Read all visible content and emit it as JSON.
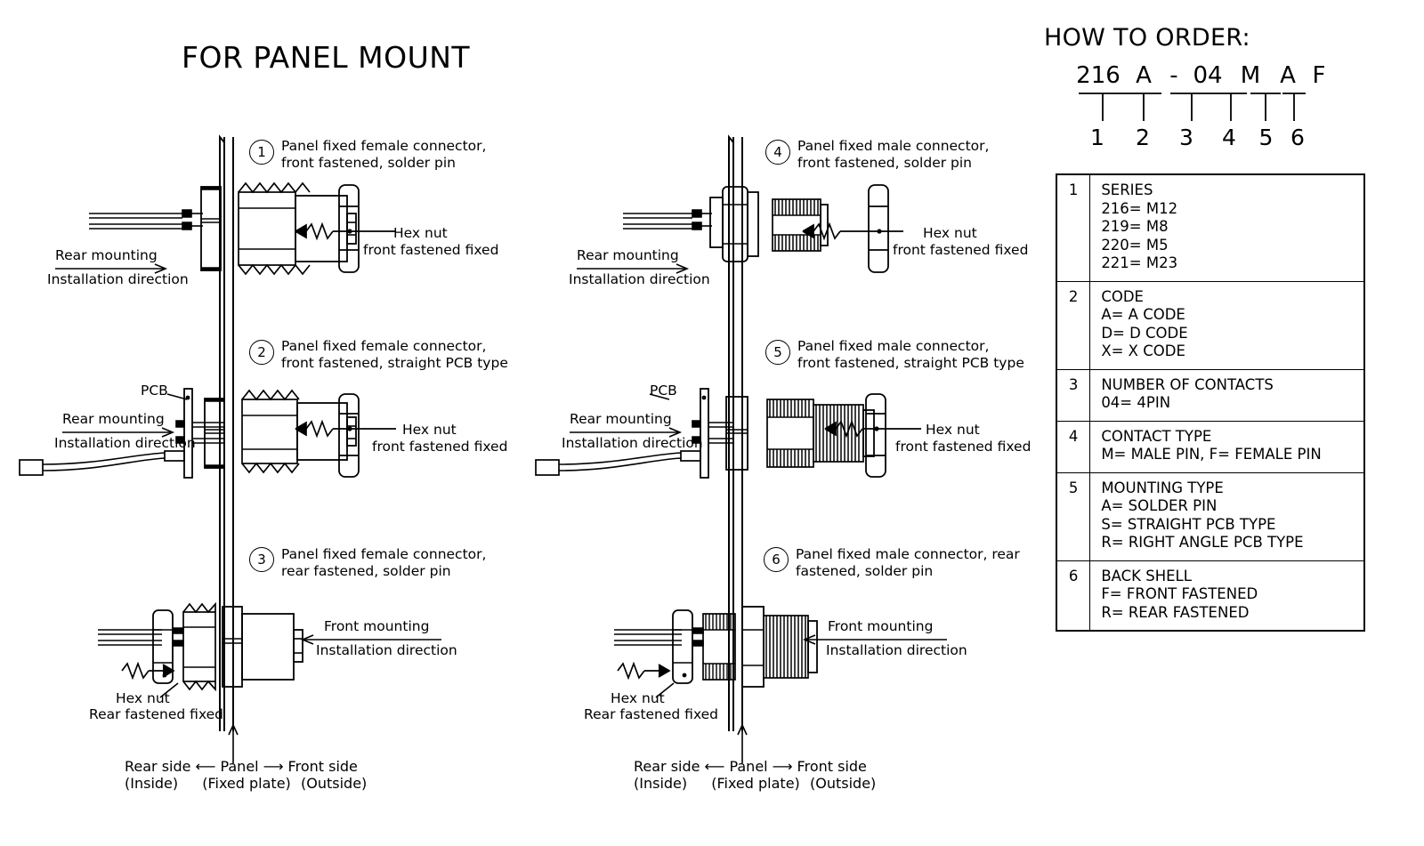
{
  "title": "FOR PANEL MOUNT",
  "order": {
    "heading": "HOW TO ORDER:",
    "code_parts": [
      "216",
      "A",
      "-",
      "04",
      "M",
      "A",
      "F"
    ],
    "code_display": "216 A - 04  M  A  F",
    "index_numbers": [
      "1",
      "2",
      "3",
      "4",
      "5",
      "6"
    ]
  },
  "spec_rows": [
    {
      "index": "1",
      "heading": "SERIES",
      "lines": [
        "216= M12",
        "219= M8",
        "220= M5",
        "221= M23"
      ]
    },
    {
      "index": "2",
      "heading": "CODE",
      "lines": [
        "A= A CODE",
        "D= D CODE",
        "X= X CODE"
      ]
    },
    {
      "index": "3",
      "heading": "NUMBER OF CONTACTS",
      "lines": [
        "04= 4PIN"
      ]
    },
    {
      "index": "4",
      "heading": "CONTACT TYPE",
      "lines": [
        "M= MALE PIN, F= FEMALE PIN"
      ]
    },
    {
      "index": "5",
      "heading": "MOUNTING TYPE",
      "lines": [
        "A= SOLDER PIN",
        "S= STRAIGHT PCB TYPE",
        "R= RIGHT ANGLE PCB TYPE"
      ]
    },
    {
      "index": "6",
      "heading": "BACK SHELL",
      "lines": [
        "F= FRONT FASTENED",
        "R= REAR FASTENED"
      ]
    }
  ],
  "callouts": [
    {
      "number": "1",
      "line1": "Panel fixed female connector,",
      "line2": "front fastened, solder pin"
    },
    {
      "number": "2",
      "line1": "Panel fixed female connector,",
      "line2": "front fastened, straight PCB type"
    },
    {
      "number": "3",
      "line1": "Panel fixed female connector,",
      "line2": "rear fastened, solder pin"
    },
    {
      "number": "4",
      "line1": "Panel fixed male connector,",
      "line2": "front fastened, solder pin"
    },
    {
      "number": "5",
      "line1": "Panel fixed male connector,",
      "line2": "front fastened, straight PCB type"
    },
    {
      "number": "6",
      "line1": "Panel fixed male connector, rear",
      "line2": "fastened, solder pin"
    }
  ],
  "annotations": {
    "rear_mounting": "Rear mounting",
    "front_mounting": "Front mounting",
    "installation_direction": "Installation direction",
    "hex_nut": "Hex nut",
    "hex_nut_front": "front fastened fixed",
    "hex_nut_rear_l1": "Hex nut",
    "hex_nut_rear_l2": "Rear fastened fixed",
    "pcb": "PCB"
  },
  "panel_legend": {
    "rear_side": "Rear side",
    "rear_side_sub": "(Inside)",
    "panel": "Panel",
    "panel_sub": "(Fixed plate)",
    "front_side": "Front side",
    "front_side_sub": "(Outside)",
    "left_arrow": "⟵",
    "right_arrow": "⟶"
  },
  "colors": {
    "line": "#000000",
    "background": "#ffffff"
  }
}
